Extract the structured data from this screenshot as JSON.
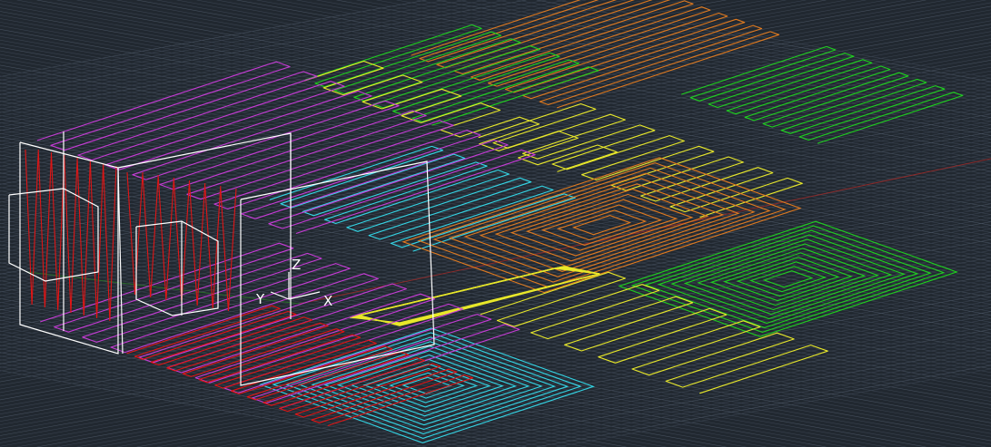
{
  "app": {
    "view": "isometric"
  },
  "colors": {
    "background": "#212830",
    "grid": "#3a4350",
    "grid_major": "#46505e",
    "orange": "#e07a1f",
    "green": "#1fd11f",
    "yellow": "#e8e82a",
    "cyan": "#33d6e6",
    "magenta": "#c63bd6",
    "red": "#e01515",
    "white": "#ffffff",
    "axis_red": "#8a2a2a",
    "axis_green": "#2a6a2a"
  },
  "ucs": {
    "z_label": "Z",
    "y_label": "Y",
    "x_label": "X"
  },
  "panels": [
    {
      "name": "orange-panel-upper",
      "color": "orange"
    },
    {
      "name": "green-panel-upper",
      "color": "green"
    },
    {
      "name": "yellow-panel-upper",
      "color": "yellow"
    },
    {
      "name": "cyan-panel-upper",
      "color": "cyan"
    },
    {
      "name": "orange-panel-lower",
      "color": "orange"
    },
    {
      "name": "green-panel-lower",
      "color": "green"
    },
    {
      "name": "yellow-panel-lower",
      "color": "yellow"
    },
    {
      "name": "cyan-panel-lower",
      "color": "cyan"
    },
    {
      "name": "magenta-roof-panel",
      "color": "magenta"
    },
    {
      "name": "magenta-floor-panel",
      "color": "magenta"
    },
    {
      "name": "red-floor-panel",
      "color": "red"
    },
    {
      "name": "red-wall-panel",
      "color": "red"
    }
  ]
}
